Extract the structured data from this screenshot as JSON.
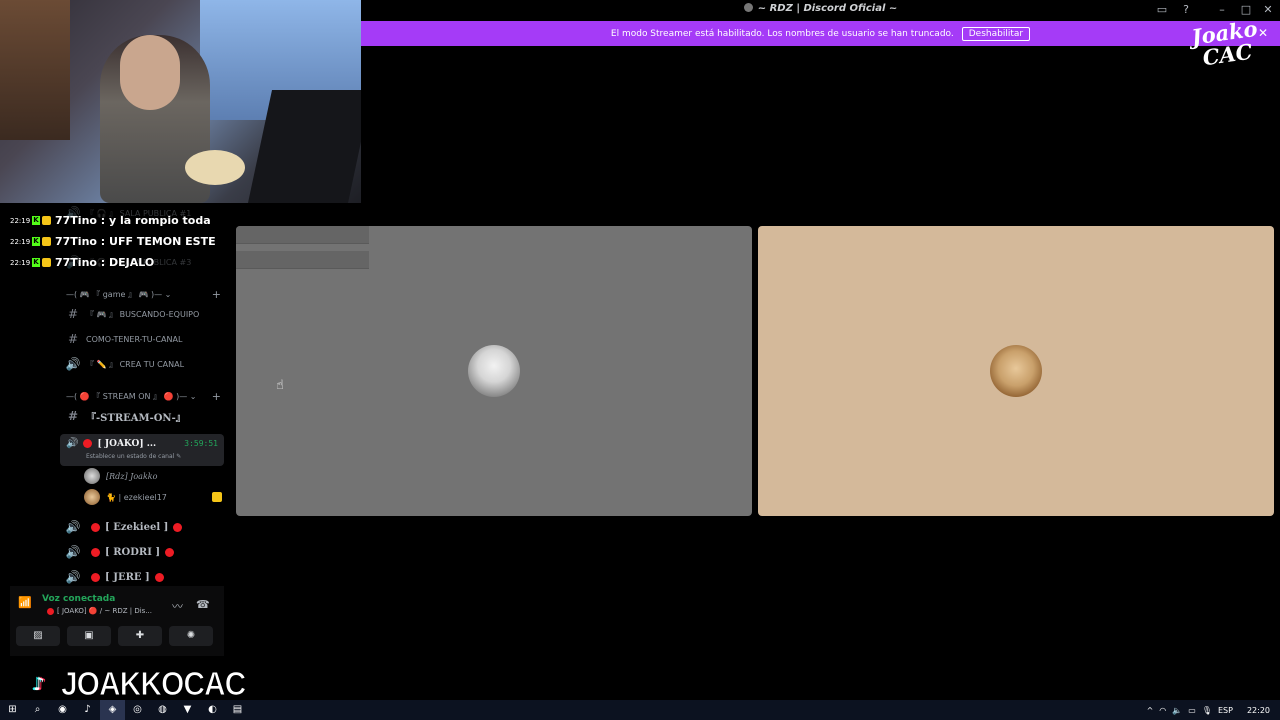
{
  "titlebar": {
    "title": "~ RDZ | Discord Oficial ~"
  },
  "banner": {
    "text": "El modo Streamer está habilitado. Los nombres de usuario se han truncado.",
    "button_label": "Deshabilitar"
  },
  "chat": [
    {
      "time": "22:19",
      "message": "77Tino : y la rompio toda"
    },
    {
      "time": "22:19",
      "message": "77Tino : UFF TEMON ESTE"
    },
    {
      "time": "22:19",
      "message": "77Tino : DEJALO"
    }
  ],
  "sidebar": {
    "hidden_channels": [
      "『 🎧 』 SALA PUBLICA #1",
      "『 🎧 』 SALA PUBLICA #3"
    ],
    "category_game": "—( 🎮 『 game 』 🎮 )— ⌄",
    "channels_game": [
      {
        "icon": "#",
        "label": "『 🎮 』 BUSCANDO-EQUIPO"
      },
      {
        "icon": "#",
        "label": "COMO-TENER-TU-CANAL"
      },
      {
        "icon": "🔊",
        "label": "『 ✏️ 』 CREA TU CANAL"
      }
    ],
    "category_stream": "—( 🔴 『 STREAM ON 』 🔴 )— ⌄",
    "channel_stream_text": "『-STREAM-ON-』",
    "active_voice": {
      "name": "[ JOAKO] ...",
      "timer": "3:59:51",
      "status": "Establece un estado de canal"
    },
    "members": [
      {
        "name": "[Rdz] Joakko"
      },
      {
        "name": "🐈 | ezekieel17"
      }
    ],
    "voice_channels": [
      {
        "name": "[ Ezekieel ]"
      },
      {
        "name": "[ RODRI ]"
      },
      {
        "name": "[ JERE ]"
      }
    ]
  },
  "voice_panel": {
    "status": "Voz conectada",
    "channel": "[ JOAKO] 🔴 / ~ RDZ | Dis..."
  },
  "watermark": {
    "handle": "JOAKKOCAC"
  },
  "brand": {
    "line1": "Joako",
    "line2": "CAC"
  },
  "taskbar": {
    "language": "ESP",
    "time": "22:20"
  },
  "colors": {
    "banner": "#a53bf7",
    "online_green": "#23a55a",
    "live_red": "#ed1c24",
    "tile_left": "#737373",
    "tile_right": "#d4b99a"
  }
}
